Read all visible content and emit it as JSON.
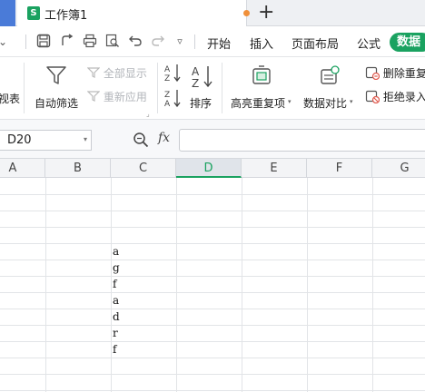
{
  "tab": {
    "title": "工作簿1",
    "plus": "+"
  },
  "menu": {
    "items": [
      "开始",
      "插入",
      "页面布局",
      "公式"
    ],
    "active": "数据"
  },
  "ribbon": {
    "left_fragment": "视表",
    "autofilter": "自动筛选",
    "show_all": "全部显示",
    "reapply": "重新应用",
    "sort": "排序",
    "highlight_dup": "高亮重复项",
    "compare": "数据对比",
    "remove_dup": "删除重复",
    "reject_dup": "拒绝录入"
  },
  "formula_bar": {
    "name_box": "D20",
    "fx": "fx",
    "formula": ""
  },
  "grid": {
    "columns": [
      "A",
      "B",
      "C",
      "D",
      "E",
      "F",
      "G"
    ],
    "active_column": "D",
    "column_c_values": [
      "a",
      "g",
      "f",
      "a",
      "d",
      "r",
      "f"
    ]
  },
  "colors": {
    "accent": "#1aa260",
    "tab_blue": "#4a7bd8",
    "modified_dot": "#f0903a"
  }
}
